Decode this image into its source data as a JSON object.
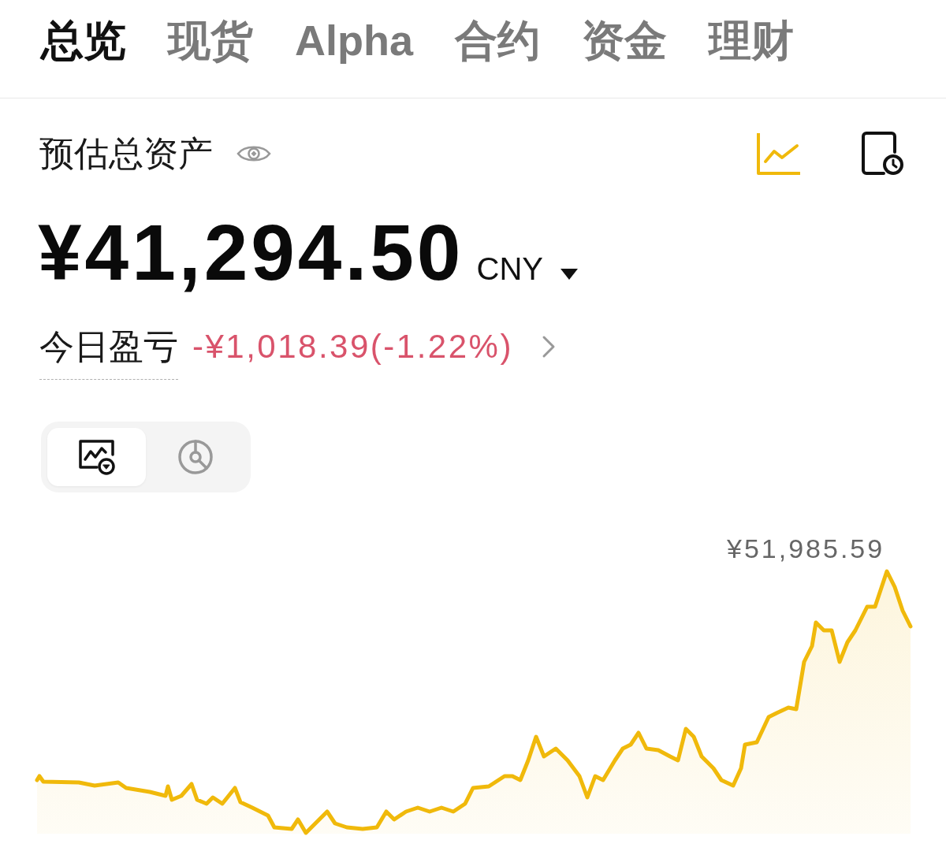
{
  "tabs": [
    {
      "label": "总览",
      "selected": true
    },
    {
      "label": "现货",
      "selected": false
    },
    {
      "label": "Alpha",
      "selected": false
    },
    {
      "label": "合约",
      "selected": false
    },
    {
      "label": "资金",
      "selected": false
    },
    {
      "label": "理财",
      "selected": false
    }
  ],
  "summary": {
    "title": "预估总资产",
    "amount": "¥41,294.50",
    "currency": "CNY",
    "pnl_label": "今日盈亏",
    "pnl_value": "-¥1,018.39(-1.22%)"
  },
  "view_toggle": [
    {
      "kind": "trend",
      "selected": true
    },
    {
      "kind": "allocation",
      "selected": false
    }
  ],
  "chart": {
    "max_label": "¥51,985.59"
  }
}
